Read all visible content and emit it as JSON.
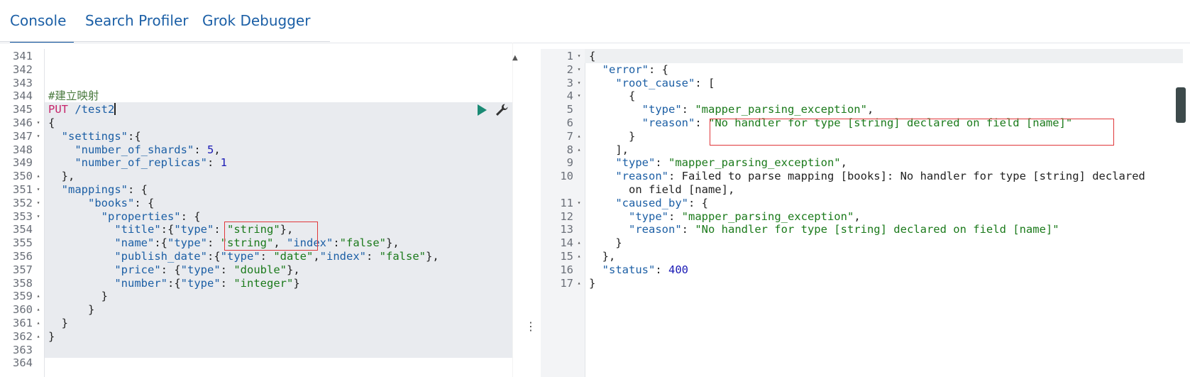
{
  "tabs": [
    {
      "label": "Console",
      "active": true
    },
    {
      "label": "Search Profiler",
      "active": false
    },
    {
      "label": "Grok Debugger",
      "active": false
    }
  ],
  "request_editor": {
    "lines": [
      {
        "num": "341",
        "fold": "",
        "code": ""
      },
      {
        "num": "342",
        "fold": "",
        "code": ""
      },
      {
        "num": "343",
        "fold": "",
        "code": ""
      },
      {
        "num": "344",
        "fold": "",
        "code": "#建立映射"
      },
      {
        "num": "345",
        "fold": "",
        "code": "PUT /test2"
      },
      {
        "num": "346",
        "fold": "▾",
        "code": "{"
      },
      {
        "num": "347",
        "fold": "▾",
        "code": "  \"settings\":{"
      },
      {
        "num": "348",
        "fold": "",
        "code": "    \"number_of_shards\": 5,"
      },
      {
        "num": "349",
        "fold": "",
        "code": "    \"number_of_replicas\": 1"
      },
      {
        "num": "350",
        "fold": "▴",
        "code": "  },"
      },
      {
        "num": "351",
        "fold": "▾",
        "code": "  \"mappings\": {"
      },
      {
        "num": "352",
        "fold": "▾",
        "code": "      \"books\": {"
      },
      {
        "num": "353",
        "fold": "▾",
        "code": "        \"properties\": {"
      },
      {
        "num": "354",
        "fold": "",
        "code": "          \"title\":{\"type\": \"string\"},"
      },
      {
        "num": "355",
        "fold": "",
        "code": "          \"name\":{\"type\": \"string\", \"index\":\"false\"},"
      },
      {
        "num": "356",
        "fold": "",
        "code": "          \"publish_date\":{\"type\": \"date\",\"index\": \"false\"},"
      },
      {
        "num": "357",
        "fold": "",
        "code": "          \"price\": {\"type\": \"double\"},"
      },
      {
        "num": "358",
        "fold": "",
        "code": "          \"number\":{\"type\": \"integer\"}"
      },
      {
        "num": "359",
        "fold": "▴",
        "code": "        }"
      },
      {
        "num": "360",
        "fold": "▴",
        "code": "      }"
      },
      {
        "num": "361",
        "fold": "▴",
        "code": "  }"
      },
      {
        "num": "362",
        "fold": "▴",
        "code": "}"
      },
      {
        "num": "363",
        "fold": "",
        "code": ""
      },
      {
        "num": "364",
        "fold": "",
        "code": ""
      }
    ]
  },
  "response_editor": {
    "lines": [
      {
        "num": "1",
        "fold": "▾",
        "code": "{"
      },
      {
        "num": "2",
        "fold": "▾",
        "code": "  \"error\": {"
      },
      {
        "num": "3",
        "fold": "▾",
        "code": "    \"root_cause\": ["
      },
      {
        "num": "4",
        "fold": "▾",
        "code": "      {"
      },
      {
        "num": "5",
        "fold": "",
        "code": "        \"type\": \"mapper_parsing_exception\","
      },
      {
        "num": "6",
        "fold": "",
        "code": "        \"reason\": \"No handler for type [string] declared on field [name]\""
      },
      {
        "num": "7",
        "fold": "▴",
        "code": "      }"
      },
      {
        "num": "8",
        "fold": "▴",
        "code": "    ],"
      },
      {
        "num": "9",
        "fold": "",
        "code": "    \"type\": \"mapper_parsing_exception\","
      },
      {
        "num": "10",
        "fold": "",
        "code": "    \"reason\": \"Failed to parse mapping [books]: No handler for type [string] declared"
      },
      {
        "num": "",
        "fold": "",
        "code": "      on field [name]\","
      },
      {
        "num": "11",
        "fold": "▾",
        "code": "    \"caused_by\": {"
      },
      {
        "num": "12",
        "fold": "",
        "code": "      \"type\": \"mapper_parsing_exception\","
      },
      {
        "num": "13",
        "fold": "",
        "code": "      \"reason\": \"No handler for type [string] declared on field [name]\""
      },
      {
        "num": "14",
        "fold": "▴",
        "code": "    }"
      },
      {
        "num": "15",
        "fold": "▴",
        "code": "  },"
      },
      {
        "num": "16",
        "fold": "",
        "code": "  \"status\": 400"
      },
      {
        "num": "17",
        "fold": "▴",
        "code": "}"
      }
    ]
  },
  "icons": {
    "run": "play-icon",
    "settings": "wrench-icon",
    "split": "vertical-ellipsis-icon"
  },
  "colors": {
    "accent": "#1b5fa6",
    "string": "#1b7a1b",
    "number": "#1a1ab5",
    "method": "#c7256b",
    "highlight_box": "#e0373a"
  }
}
